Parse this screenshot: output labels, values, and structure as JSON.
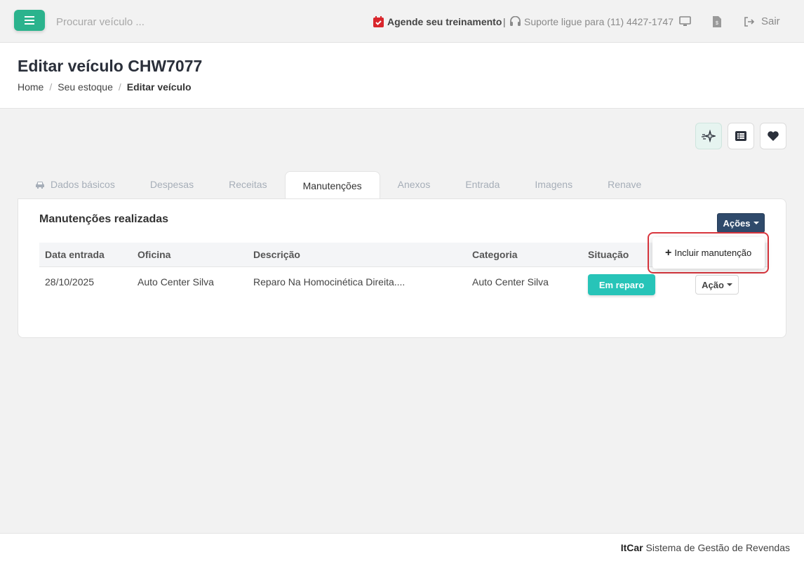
{
  "topbar": {
    "search_placeholder": "Procurar veículo ...",
    "agende_label": "Agende seu treinamento",
    "separator": "|",
    "suporte_label": "Suporte ligue para (11) 4427-1747",
    "sair_label": "Sair",
    "accent_color": "#2bb38d"
  },
  "header": {
    "title": "Editar veículo CHW7077",
    "breadcrumb": [
      "Home",
      "Seu estoque",
      "Editar veículo"
    ],
    "breadcrumb_sep": "/"
  },
  "tabs": [
    {
      "label": "Dados básicos",
      "icon": "car-icon"
    },
    {
      "label": "Despesas"
    },
    {
      "label": "Receitas"
    },
    {
      "label": "Manutenções",
      "active": true
    },
    {
      "label": "Anexos"
    },
    {
      "label": "Entrada"
    },
    {
      "label": "Imagens"
    },
    {
      "label": "Renave"
    }
  ],
  "card": {
    "title": "Manutenções realizadas",
    "acoes_label": "Ações",
    "columns": [
      "Data entrada",
      "Oficina",
      "Descrição",
      "Categoria",
      "Situação"
    ],
    "rows": [
      {
        "data": "28/10/2025",
        "oficina": "Auto Center Silva",
        "descricao": "Reparo Na Homocinética Direita....",
        "categoria": "Auto Center Silva",
        "situacao": "Em reparo",
        "acao_label": "Ação"
      }
    ]
  },
  "dropdown": {
    "item_label": "Incluir manutenção",
    "item_icon": "plus"
  },
  "footer": {
    "brand": "ItCar",
    "text": "Sistema de Gestão de Revendas"
  }
}
